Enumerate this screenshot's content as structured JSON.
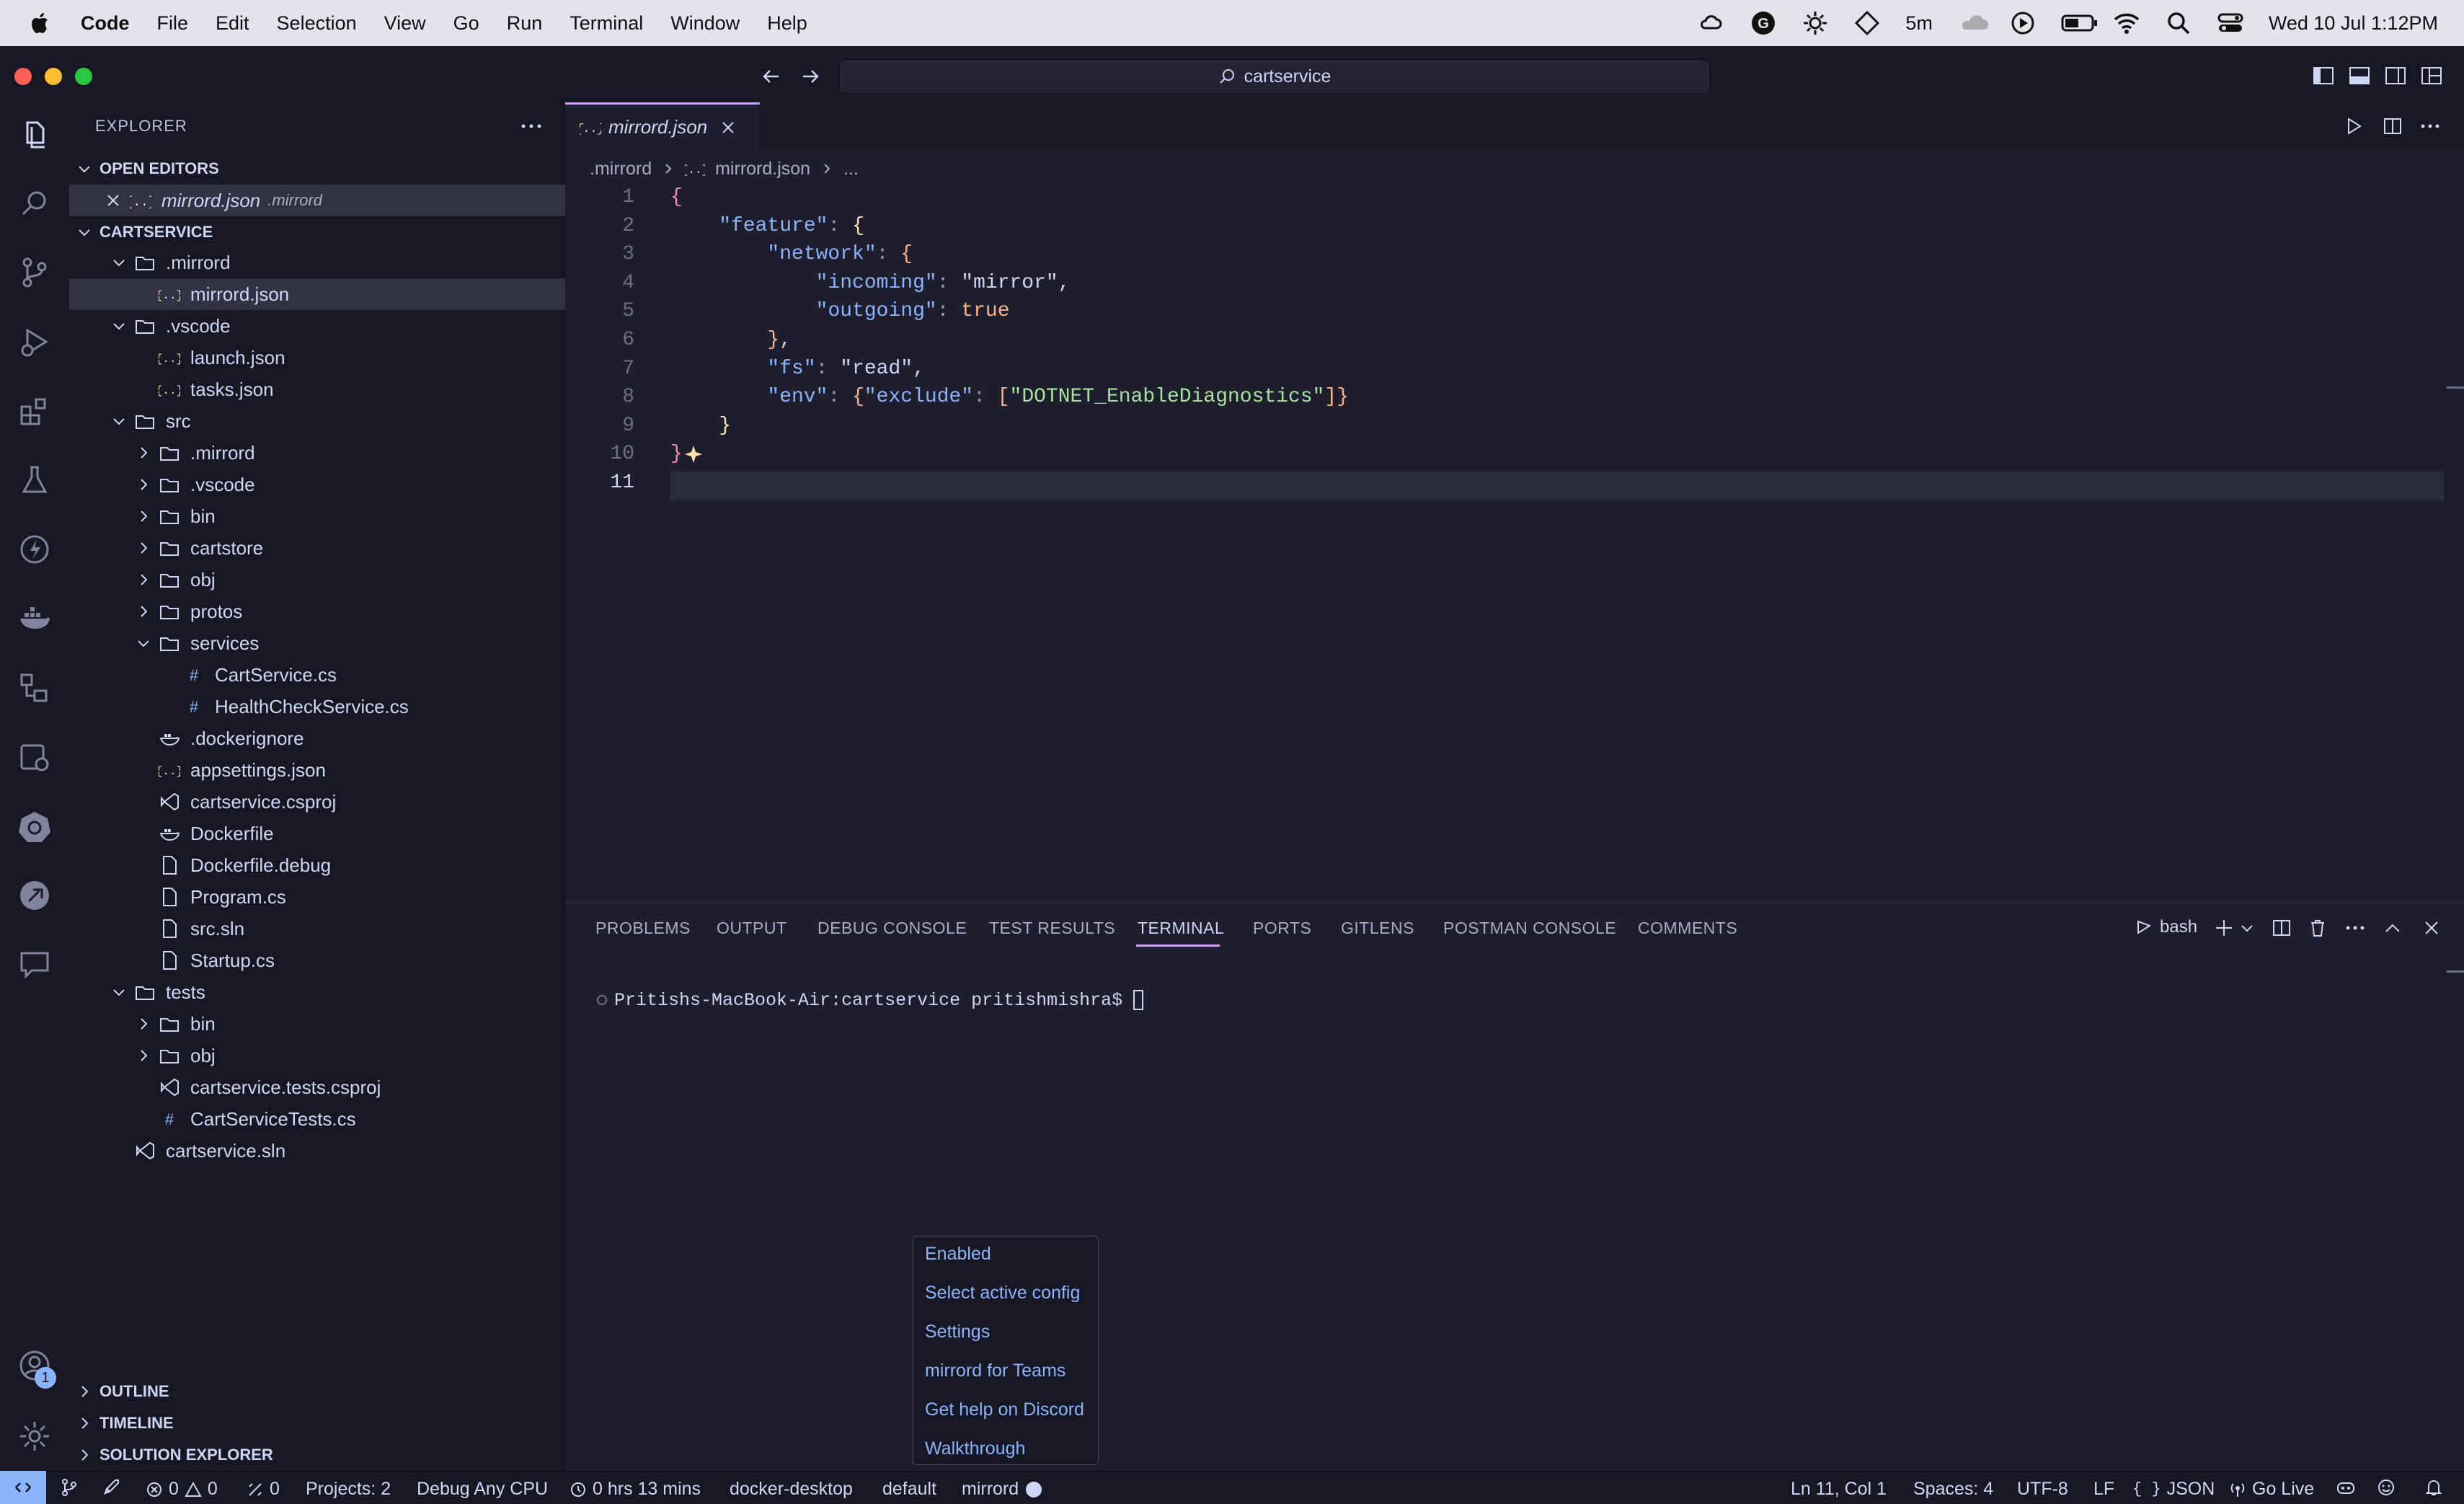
{
  "menubar": {
    "app": "Code",
    "menus": [
      "File",
      "Edit",
      "Selection",
      "View",
      "Go",
      "Run",
      "Terminal",
      "Window",
      "Help"
    ],
    "timer": "5m",
    "clock": "Wed 10 Jul  1:12PM"
  },
  "titlebar": {
    "search_text": "cartservice"
  },
  "sidebar": {
    "title": "EXPLORER",
    "open_editors_label": "OPEN EDITORS",
    "open_editor": {
      "name": "mirrord.json",
      "path": ".mirrord"
    },
    "root_label": "CARTSERVICE",
    "tree": [
      {
        "label": ".mirrord",
        "type": "folder-open"
      },
      {
        "label": "mirrord.json",
        "type": "json",
        "selected": true
      },
      {
        "label": ".vscode",
        "type": "folder-open"
      },
      {
        "label": "launch.json",
        "type": "json"
      },
      {
        "label": "tasks.json",
        "type": "json"
      },
      {
        "label": "src",
        "type": "folder-open"
      },
      {
        "label": ".mirrord",
        "type": "folder"
      },
      {
        "label": ".vscode",
        "type": "folder"
      },
      {
        "label": "bin",
        "type": "folder"
      },
      {
        "label": "cartstore",
        "type": "folder"
      },
      {
        "label": "obj",
        "type": "folder"
      },
      {
        "label": "protos",
        "type": "folder"
      },
      {
        "label": "services",
        "type": "folder-open"
      },
      {
        "label": "CartService.cs",
        "type": "cs"
      },
      {
        "label": "HealthCheckService.cs",
        "type": "cs"
      },
      {
        "label": ".dockerignore",
        "type": "docker"
      },
      {
        "label": "appsettings.json",
        "type": "json"
      },
      {
        "label": "cartservice.csproj",
        "type": "vs"
      },
      {
        "label": "Dockerfile",
        "type": "docker"
      },
      {
        "label": "Dockerfile.debug",
        "type": "file"
      },
      {
        "label": "Program.cs",
        "type": "file"
      },
      {
        "label": "src.sln",
        "type": "file"
      },
      {
        "label": "Startup.cs",
        "type": "file"
      },
      {
        "label": "tests",
        "type": "folder-open"
      },
      {
        "label": "bin",
        "type": "folder"
      },
      {
        "label": "obj",
        "type": "folder"
      },
      {
        "label": "cartservice.tests.csproj",
        "type": "vs"
      },
      {
        "label": "CartServiceTests.cs",
        "type": "cs"
      },
      {
        "label": "cartservice.sln",
        "type": "vs"
      }
    ],
    "bottom_sections": [
      "OUTLINE",
      "TIMELINE",
      "SOLUTION EXPLORER"
    ]
  },
  "editor": {
    "tab_label": "mirrord.json",
    "breadcrumb": [
      ".mirrord",
      "mirrord.json",
      "..."
    ],
    "line_numbers": [
      "1",
      "2",
      "3",
      "4",
      "5",
      "6",
      "7",
      "8",
      "9",
      "10",
      "11"
    ],
    "lines": [
      "{",
      "    \"feature\": {",
      "        \"network\": {",
      "            \"incoming\": \"mirror\",",
      "            \"outgoing\": true",
      "        },",
      "        \"fs\": \"read\",",
      "        \"env\": {\"exclude\": [\"DOTNET_EnableDiagnostics\"]}",
      "    }",
      "}",
      ""
    ]
  },
  "panel": {
    "tabs": [
      "PROBLEMS",
      "OUTPUT",
      "DEBUG CONSOLE",
      "TEST RESULTS",
      "TERMINAL",
      "PORTS",
      "GITLENS",
      "POSTMAN CONSOLE",
      "COMMENTS"
    ],
    "active_tab": "TERMINAL",
    "shell": "bash",
    "prompt": "Pritishs-MacBook-Air:cartservice pritishmishra$ "
  },
  "popup_menu": {
    "items": [
      "Enabled",
      "Select active config",
      "Settings",
      "mirrord for Teams",
      "Get help on Discord",
      "Walkthrough"
    ]
  },
  "statusbar": {
    "problems_errors": "0",
    "problems_warnings": "0",
    "ports": "0",
    "projects": "Projects: 2",
    "config": "Debug Any CPU",
    "time_tracked": "0 hrs 13 mins",
    "context": "docker-desktop",
    "namespace": "default",
    "mirrord": "mirrord",
    "cursor": "Ln 11, Col 1",
    "spaces": "Spaces: 4",
    "encoding": "UTF-8",
    "eol": "LF",
    "language": "JSON",
    "go_live": "Go Live",
    "accounts_badge": "1"
  }
}
